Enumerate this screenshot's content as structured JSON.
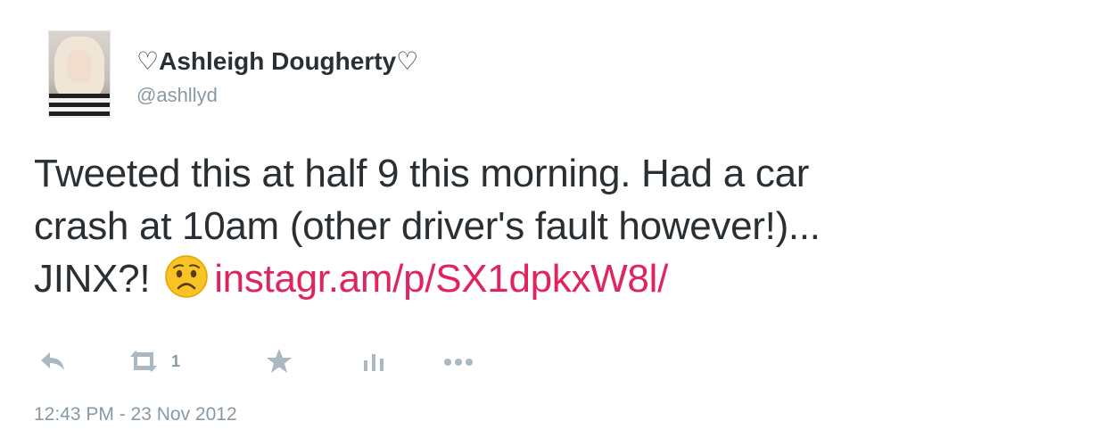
{
  "user": {
    "display_name": "♡Ashleigh Dougherty♡",
    "handle": "@ashllyd"
  },
  "tweet": {
    "line1": "Tweeted this at half 9 this morning. Had a car",
    "line2": "crash at 10am (other driver's fault however!)...",
    "line3_prefix": "JINX?!",
    "emoji": "worried-face-emoji",
    "link": "instagr.am/p/SX1dpkxW8l/",
    "link_color": "#e0245e"
  },
  "actions": {
    "reply_icon": "reply-icon",
    "retweet_icon": "retweet-icon",
    "retweet_count": "1",
    "favorite_icon": "star-icon",
    "stats_icon": "bar-chart-icon",
    "more_icon": "more-dots-icon",
    "icon_color": "#aab8c2"
  },
  "timestamp": "12:43 PM - 23 Nov 2012"
}
